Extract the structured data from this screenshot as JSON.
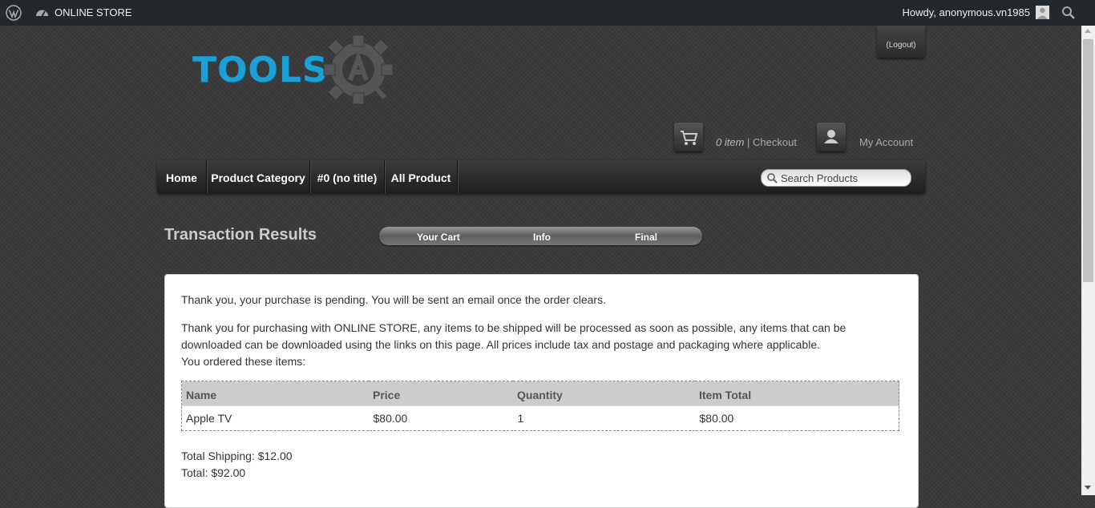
{
  "adminbar": {
    "site_name": "ONLINE STORE",
    "howdy": "Howdy, anonymous.vn1985"
  },
  "header": {
    "logo_text": "TOOLS",
    "logout_label": "(Logout)",
    "cart_count": "0 item",
    "cart_separator": " | ",
    "checkout_label": "Checkout",
    "account_label": "My Account"
  },
  "nav": {
    "items": [
      "Home",
      "Product Category",
      "#0 (no title)",
      "All Product"
    ],
    "search_placeholder": "Search Products"
  },
  "page": {
    "title": "Transaction Results",
    "steps": [
      "Your Cart",
      "Info",
      "Final"
    ]
  },
  "content": {
    "pending_msg": "Thank you, your purchase is pending. You will be sent an email once the order clears.",
    "thanks_msg": "Thank you for purchasing with ONLINE STORE, any items to be shipped will be processed as soon as possible, any items that can be downloaded can be downloaded using the links on this page. All prices include tax and postage and packaging where applicable.",
    "ordered_msg": "You ordered these items:",
    "table": {
      "headers": [
        "Name",
        "Price",
        "Quantity",
        "Item Total"
      ],
      "rows": [
        [
          "Apple TV",
          "$80.00",
          "1",
          "$80.00"
        ]
      ]
    },
    "shipping": "Total Shipping: $12.00",
    "total": "Total: $92.00"
  },
  "colors": {
    "adminbar_bg": "#23282d",
    "logo_blue": "#1e9fd6",
    "page_bg": "#3a3a3a"
  }
}
